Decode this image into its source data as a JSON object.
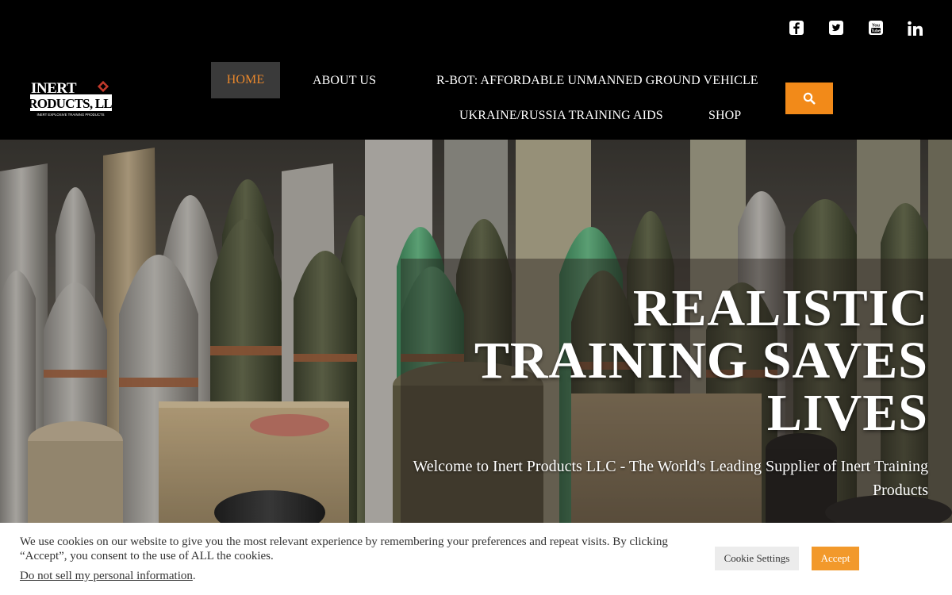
{
  "social": {
    "facebook": "facebook-icon",
    "twitter": "twitter-icon",
    "youtube": "youtube-icon",
    "youtube_text": "You Tube",
    "linkedin": "linkedin-icon"
  },
  "logo": {
    "line1": "INERT",
    "line2": "PRODUCTS, LLC",
    "tagline": "INERT EXPLOSIVE TRAINING PRODUCTS"
  },
  "nav": {
    "home": "HOME",
    "about": "ABOUT US",
    "rbot": "R-BOT: AFFORDABLE UNMANNED GROUND VEHICLE",
    "ukraine": "UKRAINE/RUSSIA TRAINING AIDS",
    "shop": "SHOP"
  },
  "search": {
    "icon": "search-icon"
  },
  "hero": {
    "title_line1": "REALISTIC",
    "title_line2": "TRAINING SAVES",
    "title_line3": "LIVES",
    "subtitle": "Welcome to Inert Products LLC - The World's Leading Supplier of Inert Training Products"
  },
  "cookie": {
    "message": "We use cookies on our website to give you the most relevant experience by remembering your preferences and repeat visits. By clicking “Accept”, you consent to the use of ALL the cookies.",
    "do_not_sell": "Do not sell my personal information",
    "do_not_sell_suffix": ".",
    "settings_label": "Cookie Settings",
    "accept_label": "Accept"
  },
  "colors": {
    "accent_orange": "#f28a19",
    "nav_active_text": "#e8872c",
    "background": "#000000"
  }
}
